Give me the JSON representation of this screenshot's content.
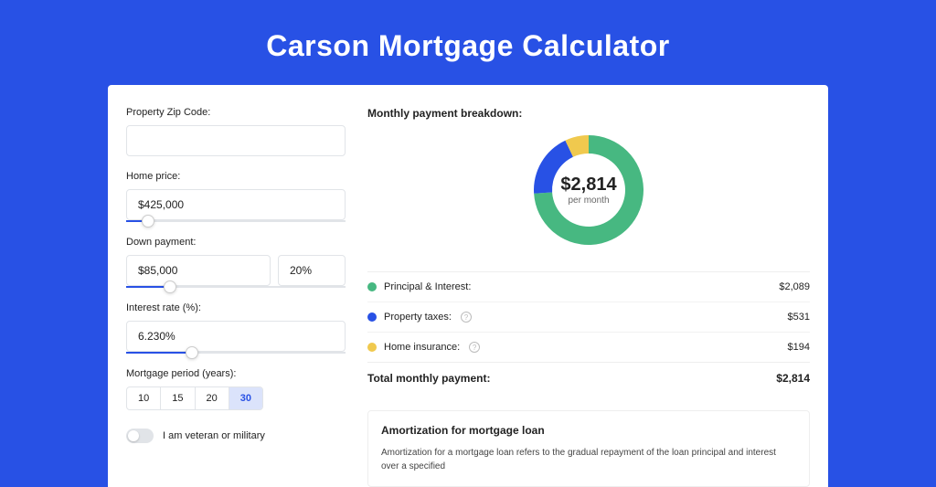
{
  "title": "Carson Mortgage Calculator",
  "form": {
    "zip": {
      "label": "Property Zip Code:",
      "value": ""
    },
    "homePrice": {
      "label": "Home price:",
      "value": "$425,000",
      "sliderPct": 10
    },
    "downPayment": {
      "label": "Down payment:",
      "value": "$85,000",
      "pct": "20%",
      "sliderPct": 20
    },
    "interest": {
      "label": "Interest rate (%):",
      "value": "6.230%",
      "sliderPct": 30
    },
    "period": {
      "label": "Mortgage period (years):",
      "options": [
        "10",
        "15",
        "20",
        "30"
      ],
      "active": "30"
    },
    "veteran": {
      "label": "I am veteran or military",
      "on": false
    }
  },
  "breakdown": {
    "heading": "Monthly payment breakdown:",
    "centerBig": "$2,814",
    "centerSm": "per month",
    "items": [
      {
        "color": "#47b881",
        "label": "Principal & Interest:",
        "value": "$2,089",
        "info": false,
        "pct": 74
      },
      {
        "color": "#2851e5",
        "label": "Property taxes:",
        "value": "$531",
        "info": true,
        "pct": 19
      },
      {
        "color": "#f0c94e",
        "label": "Home insurance:",
        "value": "$194",
        "info": true,
        "pct": 7
      }
    ],
    "totalLabel": "Total monthly payment:",
    "totalValue": "$2,814"
  },
  "amort": {
    "heading": "Amortization for mortgage loan",
    "text": "Amortization for a mortgage loan refers to the gradual repayment of the loan principal and interest over a specified"
  },
  "chart_data": {
    "type": "pie",
    "title": "Monthly payment breakdown",
    "categories": [
      "Principal & Interest",
      "Property taxes",
      "Home insurance"
    ],
    "values": [
      2089,
      531,
      194
    ],
    "colors": [
      "#47b881",
      "#2851e5",
      "#f0c94e"
    ],
    "center_label": "$2,814 per month"
  }
}
